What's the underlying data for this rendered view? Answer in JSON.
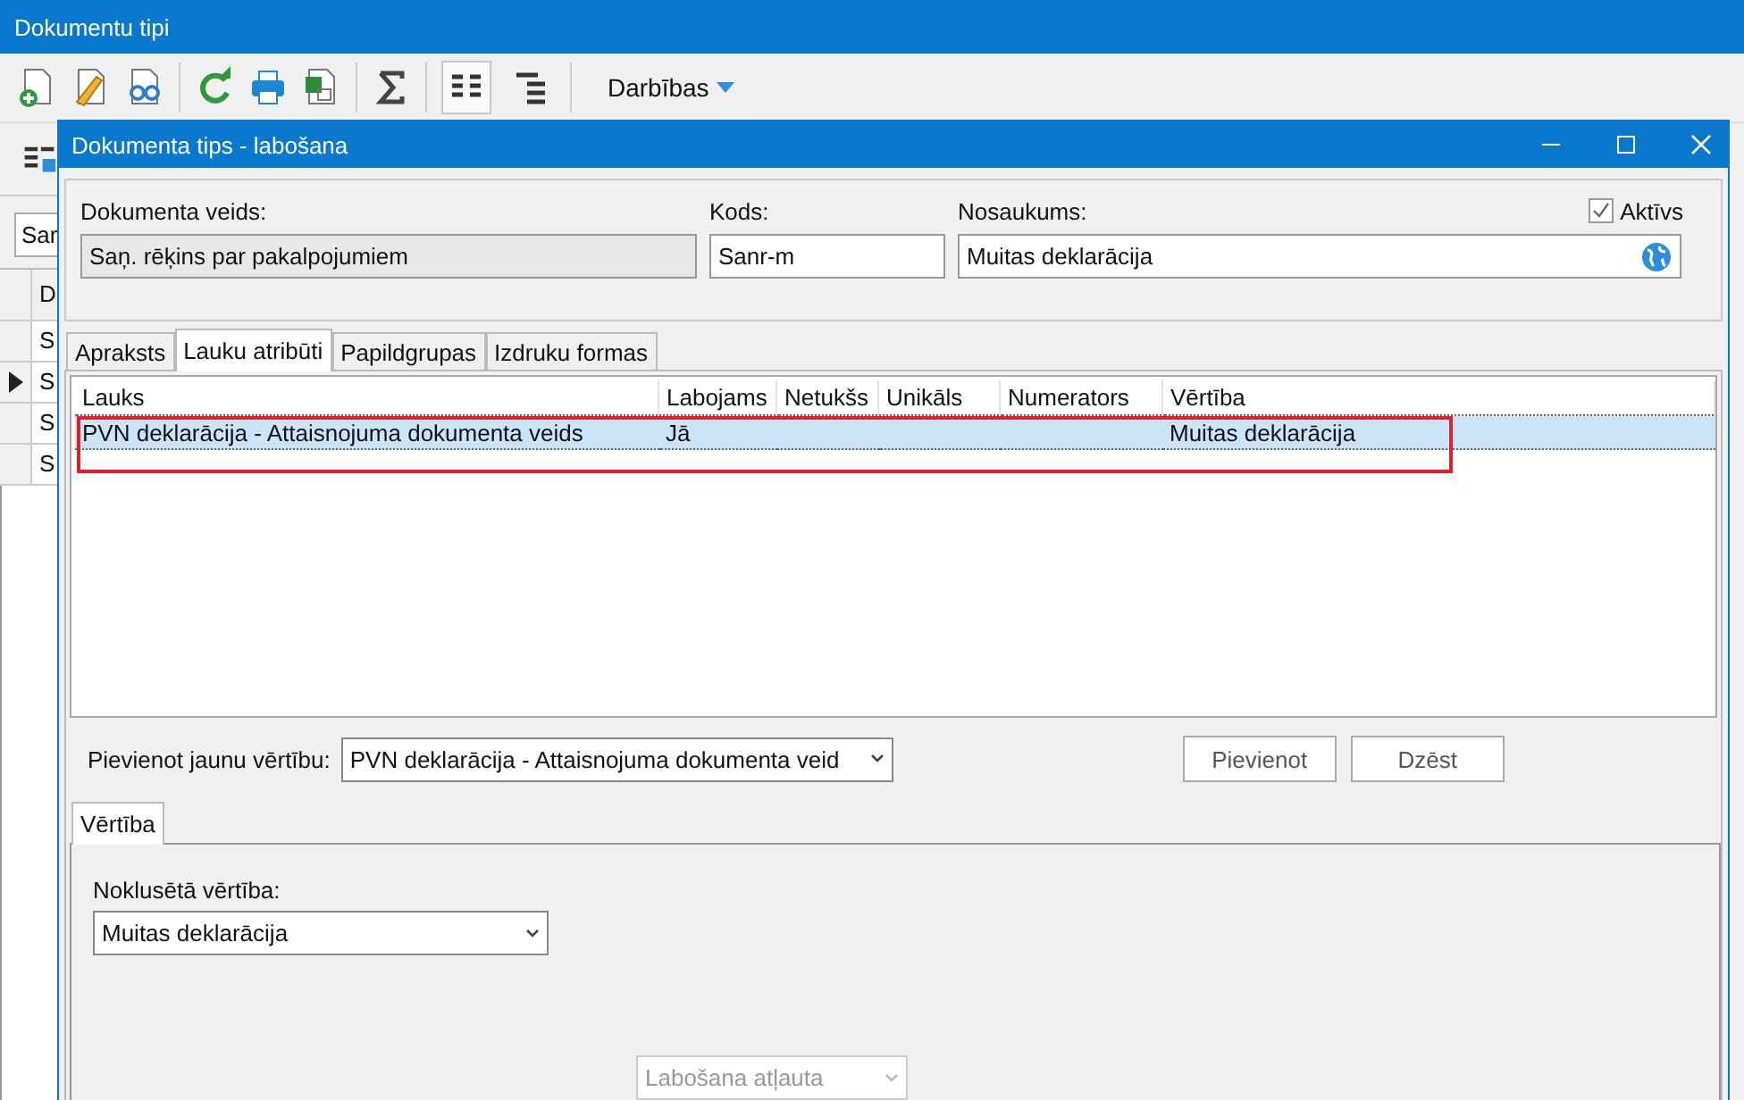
{
  "back_window": {
    "title": "Dokumentu tipi",
    "menu": "Darbības",
    "view_buttons": [
      {
        "selected": true
      },
      {
        "selected": false
      }
    ],
    "filter_value": "Sar",
    "grid_header": "D",
    "rows": [
      {
        "cell": "S",
        "selected": false
      },
      {
        "cell": "S",
        "selected": true
      },
      {
        "cell": "S",
        "selected": false
      },
      {
        "cell": "S",
        "selected": false
      }
    ]
  },
  "dialog": {
    "title": "Dokumenta tips - labošana",
    "fields": [
      {
        "label": "Dokumenta veids:",
        "value": "Saņ. rēķins par pakalpojumiem",
        "disabled": true
      },
      {
        "label": "Kods:",
        "value": "Sanr-m",
        "disabled": false
      },
      {
        "label": "Nosaukums:",
        "value": "Muitas deklarācija",
        "disabled": false
      }
    ],
    "active_checkbox": {
      "label": "Aktīvs",
      "checked": true
    },
    "tabs": [
      {
        "label": "Apraksts",
        "selected": false
      },
      {
        "label": "Lauku atribūti",
        "selected": true
      },
      {
        "label": "Papildgrupas",
        "selected": false
      },
      {
        "label": "Izdruku formas",
        "selected": false
      }
    ],
    "table": {
      "columns": [
        "Lauks",
        "Labojams",
        "Netukšs",
        "Unikāls",
        "Numerators",
        "Vērtība"
      ],
      "rows": [
        {
          "cells": [
            "PVN deklarācija - Attaisnojuma dokumenta veids",
            "Jā",
            "",
            "",
            "",
            "Muitas deklarācija"
          ],
          "selected": true,
          "highlighted": true
        }
      ]
    },
    "add_value": {
      "label": "Pievienot jaunu vērtību:",
      "value": "PVN deklarācija - Attaisnojuma dokumenta veid"
    },
    "buttons": [
      "Pievienot",
      "Dzēst"
    ],
    "sub_tabs": [
      {
        "label": "Vērtība",
        "selected": true
      }
    ],
    "default_value": {
      "label": "Noklusētā vērtība:",
      "value": "Muitas deklarācija"
    },
    "permission": {
      "value": "Labošana atļauta",
      "disabled": true
    }
  }
}
